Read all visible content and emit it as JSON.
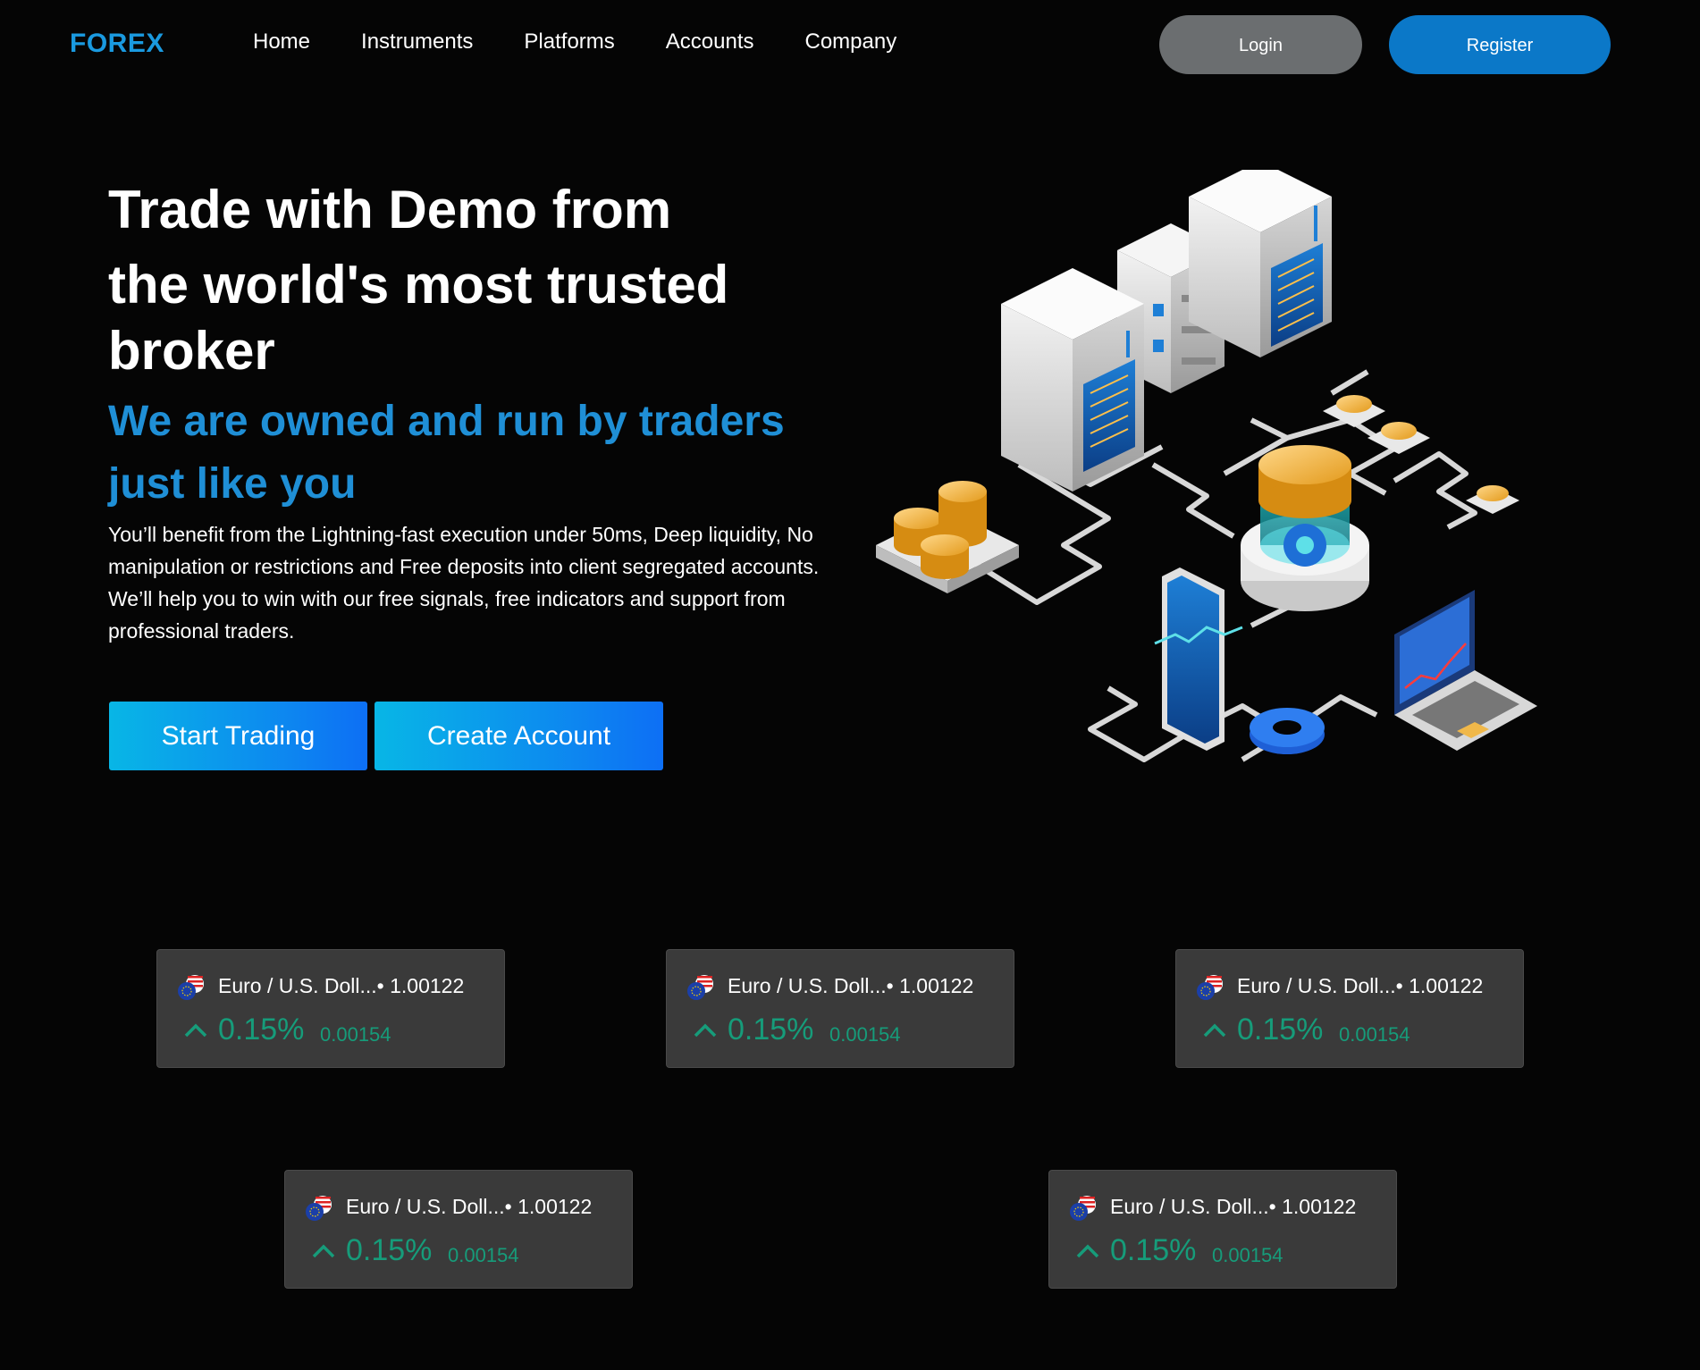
{
  "brand": {
    "logo": "FOREX",
    "accent_color": "#1a9ae0"
  },
  "nav": {
    "links": [
      "Home",
      "Instruments",
      "Platforms",
      "Accounts",
      "Company"
    ],
    "login_label": "Login",
    "register_label": "Register"
  },
  "hero": {
    "title_line1": "Trade with Demo from",
    "title_line2": "the world's most trusted broker",
    "subtitle": "We are owned and run by traders just like you",
    "description": "You’ll benefit from the Lightning-fast execution under 50ms, Deep liquidity, No manipulation or restrictions and Free deposits into client segregated accounts. We’ll help you to win with our free signals, free indicators and support from professional traders.",
    "start_label": "Start Trading",
    "create_label": "Create Account"
  },
  "tickers": [
    {
      "pair": "Euro  /  U.S. Doll...• 1.00122",
      "change_pct": "0.15%",
      "change_abs": "0.00154",
      "direction": "up"
    },
    {
      "pair": "Euro  /  U.S. Doll...• 1.00122",
      "change_pct": "0.15%",
      "change_abs": "0.00154",
      "direction": "up"
    },
    {
      "pair": "Euro  /  U.S. Doll...• 1.00122",
      "change_pct": "0.15%",
      "change_abs": "0.00154",
      "direction": "up"
    },
    {
      "pair": "Euro  /  U.S. Doll...• 1.00122",
      "change_pct": "0.15%",
      "change_abs": "0.00154",
      "direction": "up"
    },
    {
      "pair": "Euro  /  U.S. Doll...• 1.00122",
      "change_pct": "0.15%",
      "change_abs": "0.00154",
      "direction": "up"
    }
  ],
  "colors": {
    "positive": "#169c7a",
    "subtitle": "#1f8fd6",
    "register_button": "#0b78c8",
    "login_button": "#6b6e70"
  }
}
